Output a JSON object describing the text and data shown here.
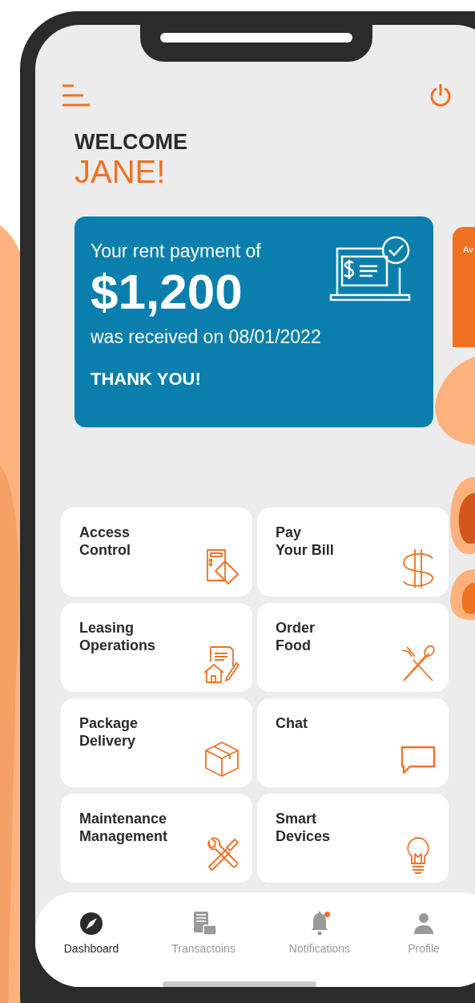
{
  "header": {
    "greeting": "WELCOME",
    "name": "JANE!"
  },
  "payment_card": {
    "intro": "Your rent payment of",
    "amount": "$1,200",
    "received": "was received on 08/01/2022",
    "thanks": "THANK YOU!"
  },
  "next_card": {
    "text": "Av"
  },
  "tiles": [
    {
      "label": "Access\nControl",
      "kind": "access"
    },
    {
      "label": "Pay\nYour Bill",
      "kind": "bill"
    },
    {
      "label": "Leasing\nOperations",
      "kind": "leasing"
    },
    {
      "label": "Order\nFood",
      "kind": "food"
    },
    {
      "label": "Package\nDelivery",
      "kind": "package"
    },
    {
      "label": "Chat",
      "kind": "chat"
    },
    {
      "label": "Maintenance\nManagement",
      "kind": "maintenance"
    },
    {
      "label": "Smart\nDevices",
      "kind": "devices"
    }
  ],
  "nav": [
    {
      "label": "Dashboard",
      "kind": "dashboard",
      "selected": true,
      "alert": false
    },
    {
      "label": "Transactoins",
      "kind": "transactions",
      "selected": false,
      "alert": false
    },
    {
      "label": "Notifications",
      "kind": "notifications",
      "selected": false,
      "alert": true
    },
    {
      "label": "Profile",
      "kind": "profile",
      "selected": false,
      "alert": false
    }
  ]
}
